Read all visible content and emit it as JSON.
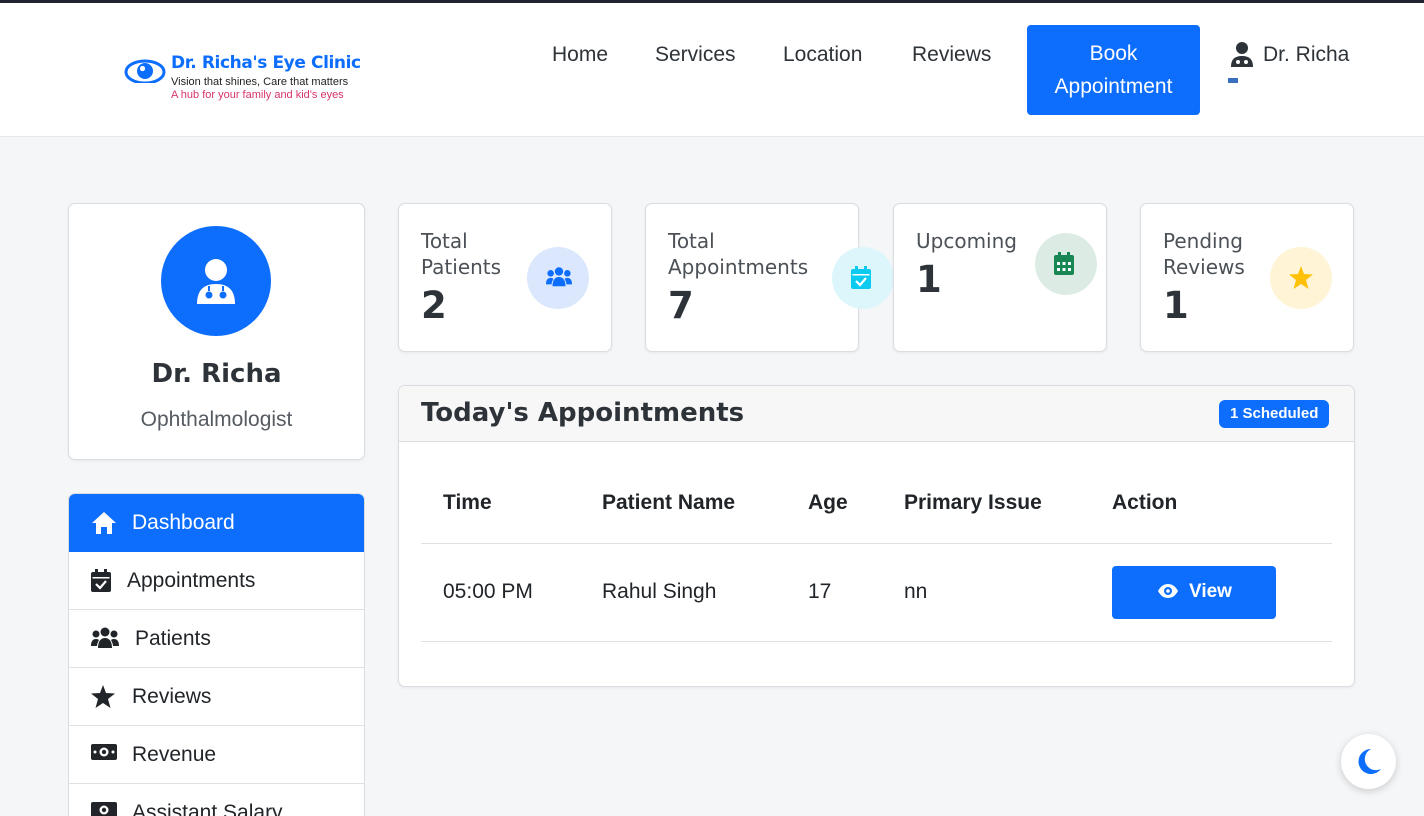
{
  "brand": {
    "name": "Dr. Richa's Eye Clinic",
    "tagline": "Vision that shines, Care that matters",
    "subtagline": "A hub for your family and kid's eyes",
    "logo_icon": "eye-icon"
  },
  "nav": {
    "items": [
      "Home",
      "Services",
      "Location",
      "Reviews"
    ],
    "book_line1": "Book",
    "book_line2": "Appointment",
    "user_name": "Dr. Richa",
    "user_icon": "user-doctor-icon"
  },
  "profile": {
    "name": "Dr. Richa",
    "role": "Ophthalmologist",
    "avatar_icon": "user-doctor-icon"
  },
  "sidebar": {
    "items": [
      {
        "label": "Dashboard",
        "icon": "home-icon",
        "active": true
      },
      {
        "label": "Appointments",
        "icon": "calendar-check-icon",
        "active": false
      },
      {
        "label": "Patients",
        "icon": "users-icon",
        "active": false
      },
      {
        "label": "Reviews",
        "icon": "star-icon",
        "active": false
      },
      {
        "label": "Revenue",
        "icon": "money-bill-icon",
        "active": false
      },
      {
        "label": "Assistant Salary",
        "icon": "money-bill-icon",
        "active": false
      }
    ]
  },
  "stats": [
    {
      "line1": "Total",
      "line2": "Patients",
      "value": "2",
      "icon": "users-icon",
      "color": "#0d6efd",
      "bg": "#dbe7fd"
    },
    {
      "line1": "Total",
      "line2": "Appointments",
      "value": "7",
      "icon": "calendar-check-icon",
      "color": "#0dcaf0",
      "bg": "#dcf6fb"
    },
    {
      "line1": "Upcoming",
      "line2": "",
      "value": "1",
      "icon": "calendar-icon",
      "color": "#198754",
      "bg": "#dcece4"
    },
    {
      "line1": "Pending",
      "line2": "Reviews",
      "value": "1",
      "icon": "star-icon",
      "color": "#ffc107",
      "bg": "#fff4d5"
    }
  ],
  "appointments": {
    "title": "Today's Appointments",
    "badge": "1 Scheduled",
    "columns": [
      "Time",
      "Patient Name",
      "Age",
      "Primary Issue",
      "Action"
    ],
    "rows": [
      {
        "time": "05:00 PM",
        "patient": "Rahul Singh",
        "age": "17",
        "issue": "nn",
        "action": "View"
      }
    ]
  },
  "theme_toggle": {
    "icon": "moon-icon"
  },
  "colors": {
    "primary": "#0d6efd",
    "pink": "#d6336c",
    "background": "#f4f6f8"
  }
}
